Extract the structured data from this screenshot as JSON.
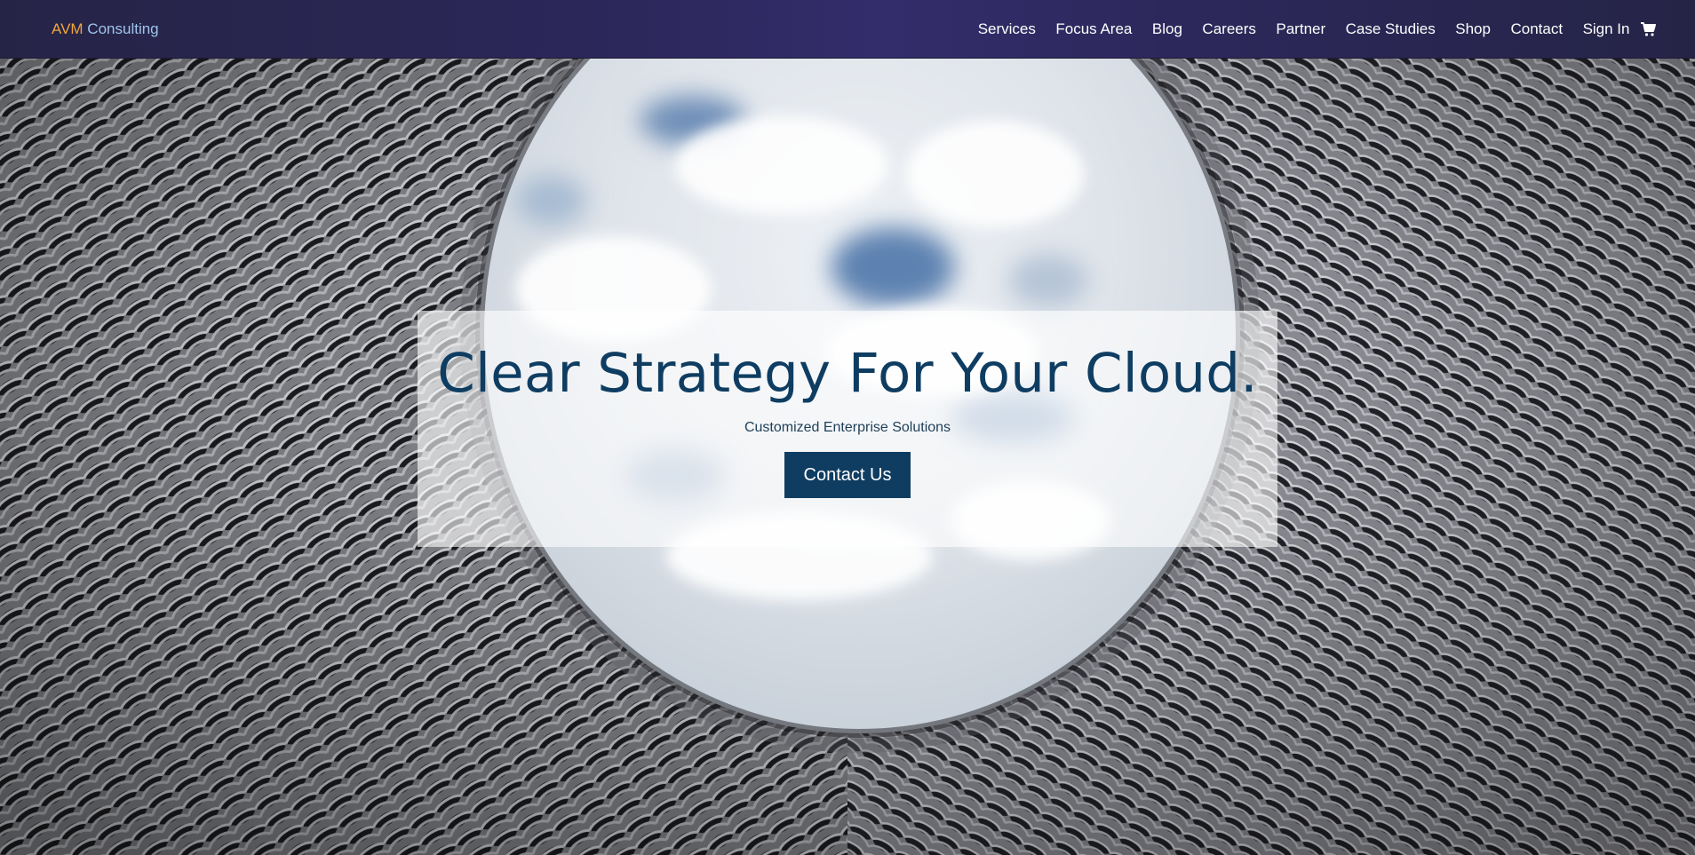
{
  "brand": {
    "part1": "AVM",
    "part2": " Consulting",
    "colors": {
      "part1": "#f0a63a",
      "part2": "#9fc4ea"
    }
  },
  "nav": {
    "items": [
      {
        "label": "Services"
      },
      {
        "label": "Focus Area"
      },
      {
        "label": "Blog"
      },
      {
        "label": "Careers"
      },
      {
        "label": "Partner"
      },
      {
        "label": "Case Studies"
      },
      {
        "label": "Shop"
      },
      {
        "label": "Contact"
      },
      {
        "label": "Sign In"
      }
    ],
    "cart_icon": "shopping-cart-icon"
  },
  "hero": {
    "title": "Clear Strategy For Your Cloud.",
    "subtitle": "Customized Enterprise Solutions",
    "cta_label": "Contact Us",
    "background_image": "architecture-woven-facade-looking-up-at-cloudy-sky"
  },
  "colors": {
    "nav_bg": "#2b2759",
    "accent": "#0f3d62",
    "hero_text": "#0f3d62"
  }
}
